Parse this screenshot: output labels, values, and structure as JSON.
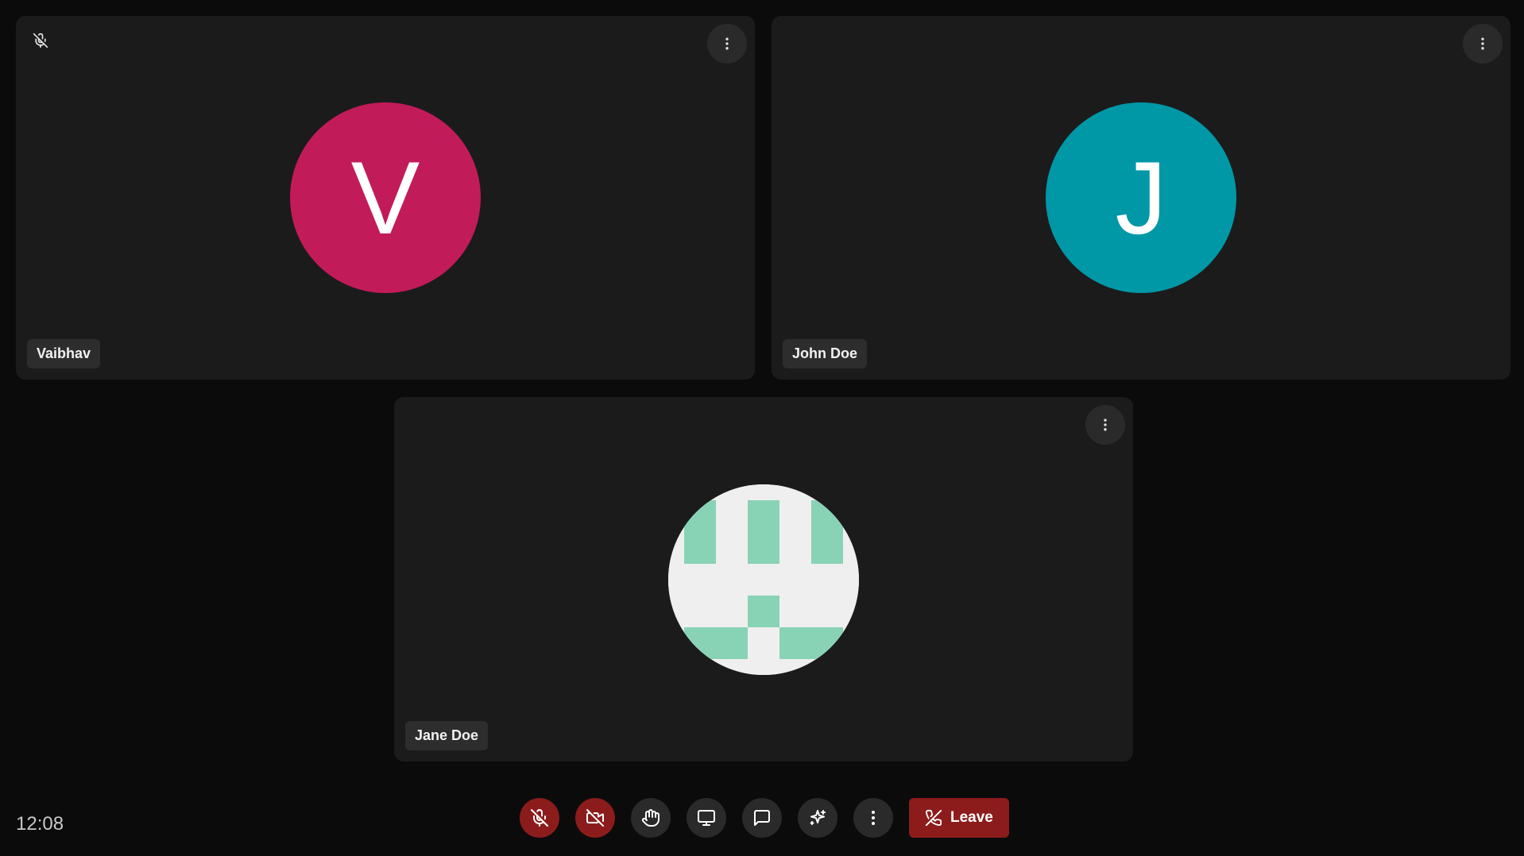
{
  "participants": [
    {
      "name": "Vaibhav",
      "initial": "V",
      "avatar_color": "#c21b5a",
      "muted": true
    },
    {
      "name": "John Doe",
      "initial": "J",
      "avatar_color": "#0097a7",
      "muted": false
    },
    {
      "name": "Jane Doe",
      "initial": "",
      "avatar_type": "identicon",
      "identicon_color": "#88d3b5",
      "identicon_bg": "#efefef",
      "muted": false
    }
  ],
  "footer": {
    "time": "12:08"
  },
  "toolbar": {
    "mic": {
      "icon": "mic-off-icon",
      "state": "off"
    },
    "camera": {
      "icon": "video-off-icon",
      "state": "off"
    },
    "raise_hand": {
      "icon": "hand-icon"
    },
    "share_screen": {
      "icon": "monitor-icon"
    },
    "chat": {
      "icon": "message-square-icon"
    },
    "effects": {
      "icon": "sparkles-icon"
    },
    "more": {
      "icon": "more-vertical-icon"
    },
    "leave": {
      "label": "Leave",
      "icon": "phone-off-icon",
      "color": "#8c1c1c"
    }
  },
  "colors": {
    "background": "#0b0b0b",
    "tile": "#1b1b1b",
    "button": "#2a2a2a",
    "danger": "#8c1c1c"
  }
}
